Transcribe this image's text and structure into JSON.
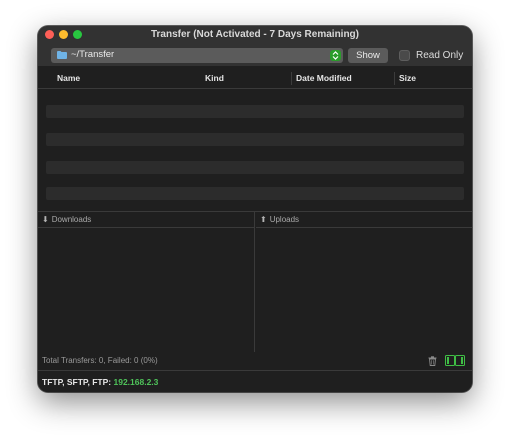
{
  "window": {
    "title": "Transfer (Not Activated - 7 Days Remaining)"
  },
  "toolbar": {
    "path": "~/Transfer",
    "show_label": "Show",
    "read_only_label": "Read Only",
    "read_only_checked": false
  },
  "table": {
    "columns": [
      "Name",
      "Kind",
      "Date Modified",
      "Size"
    ],
    "rows": []
  },
  "panes": {
    "downloads_label": "Downloads",
    "uploads_label": "Uploads"
  },
  "status": {
    "summary": "Total Transfers: 0, Failed: 0 (0%)"
  },
  "footer": {
    "protocols": "TFTP, SFTP, FTP:",
    "ip": "192.168.2.3"
  },
  "colors": {
    "ip_accent": "#4fc35a",
    "stepper_accent": "#2a9d2a"
  },
  "icons": [
    "folder-icon",
    "trash-icon",
    "layout-toggle-icon",
    "download-arrow-icon",
    "upload-arrow-icon"
  ]
}
